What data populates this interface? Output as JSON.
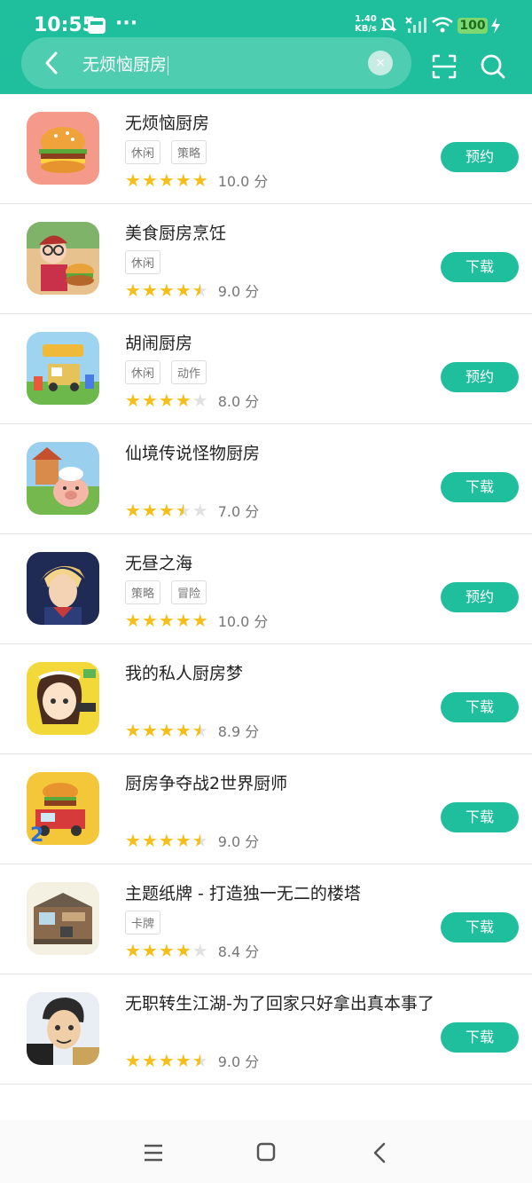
{
  "status": {
    "time": "10:55",
    "dots": "···",
    "speed_value": "1.40",
    "speed_unit": "KB/s",
    "battery": "100"
  },
  "search": {
    "query": "无烦恼厨房",
    "clear_icon": "×"
  },
  "colors": {
    "accent": "#1fbf9d",
    "star": "#f6be1a"
  },
  "games": [
    {
      "name": "无烦恼厨房",
      "tags": [
        "休闲",
        "策略"
      ],
      "rating": 5,
      "score": "10.0 分",
      "action": "预约",
      "icon": "burger-icon"
    },
    {
      "name": "美食厨房烹饪",
      "tags": [
        "休闲"
      ],
      "rating": 4.5,
      "score": "9.0 分",
      "action": "下载",
      "icon": "chef-girl-icon"
    },
    {
      "name": "胡闹厨房",
      "tags": [
        "休闲",
        "动作"
      ],
      "rating": 4,
      "score": "8.0 分",
      "action": "预约",
      "icon": "moving-out-icon"
    },
    {
      "name": "仙境传说怪物厨房",
      "tags": [],
      "rating": 3.5,
      "score": "7.0 分",
      "action": "下载",
      "icon": "pig-chef-icon"
    },
    {
      "name": "无昼之海",
      "tags": [
        "策略",
        "冒险"
      ],
      "rating": 5,
      "score": "10.0 分",
      "action": "预约",
      "icon": "hero-icon"
    },
    {
      "name": "我的私人厨房梦",
      "tags": [],
      "rating": 4.5,
      "score": "8.9 分",
      "action": "下载",
      "icon": "cook-girl-icon"
    },
    {
      "name": "厨房争夺战2世界厨师",
      "tags": [],
      "rating": 4.5,
      "score": "9.0 分",
      "action": "下载",
      "icon": "food-truck-icon"
    },
    {
      "name": "主题纸牌 - 打造独一无二的楼塔",
      "tags": [
        "卡牌"
      ],
      "rating": 4,
      "score": "8.4 分",
      "action": "下载",
      "icon": "room-icon"
    },
    {
      "name": "无职转生江湖-为了回家只好拿出真本事了",
      "tags": [],
      "rating": 4.5,
      "score": "9.0 分",
      "action": "下载",
      "icon": "warrior-icon"
    }
  ]
}
